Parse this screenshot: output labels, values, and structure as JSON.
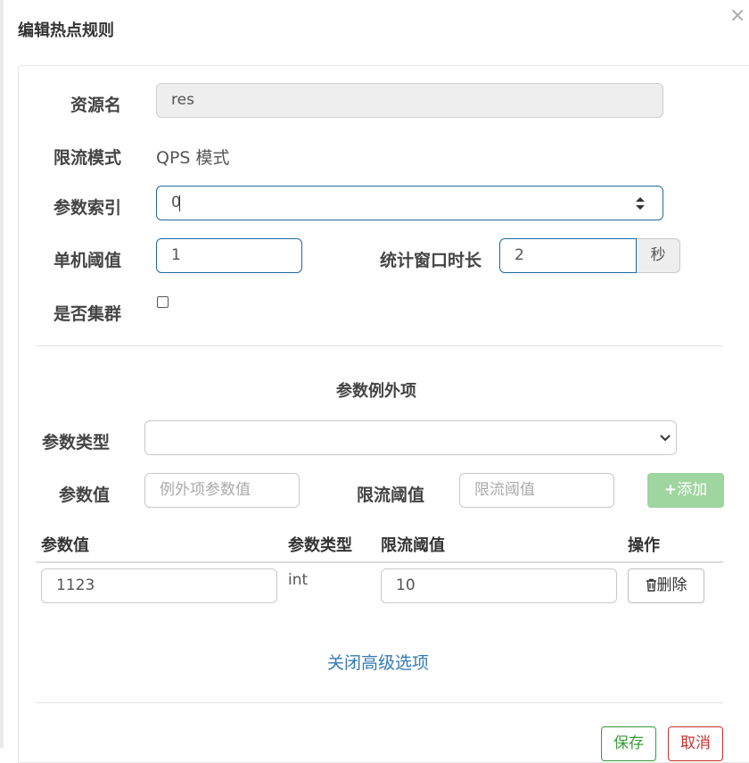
{
  "dialog": {
    "title": "编辑热点规则"
  },
  "form": {
    "resource_label": "资源名",
    "resource_value": "res",
    "mode_label": "限流模式",
    "mode_value": "QPS 模式",
    "param_index_label": "参数索引",
    "param_index_value": "0",
    "threshold_label": "单机阈值",
    "threshold_value": "1",
    "window_label": "统计窗口时长",
    "window_value": "2",
    "window_unit": "秒",
    "cluster_label": "是否集群"
  },
  "exceptions": {
    "section_title": "参数例外项",
    "type_label": "参数类型",
    "value_label": "参数值",
    "value_placeholder": "例外项参数值",
    "limit_label": "限流阈值",
    "limit_placeholder": "限流阈值",
    "add_label": "添加",
    "columns": [
      "参数值",
      "参数类型",
      "限流阈值",
      "操作"
    ],
    "rows": [
      {
        "value": "1123",
        "type": "int",
        "limit": "10",
        "action": "删除"
      }
    ],
    "toggle_label": "关闭高级选项"
  },
  "footer": {
    "save_label": "保存",
    "cancel_label": "取消"
  },
  "icons": {
    "close": "close-icon",
    "add": "plus-icon",
    "delete": "trash-icon",
    "select": "chevron-down-icon",
    "stepper": "stepper-icon"
  },
  "colors": {
    "focus_border": "#1f6aa5",
    "add_button": "#9fd59f",
    "link": "#337ab7",
    "save": "#3a9a3a",
    "cancel": "#c9302c"
  }
}
